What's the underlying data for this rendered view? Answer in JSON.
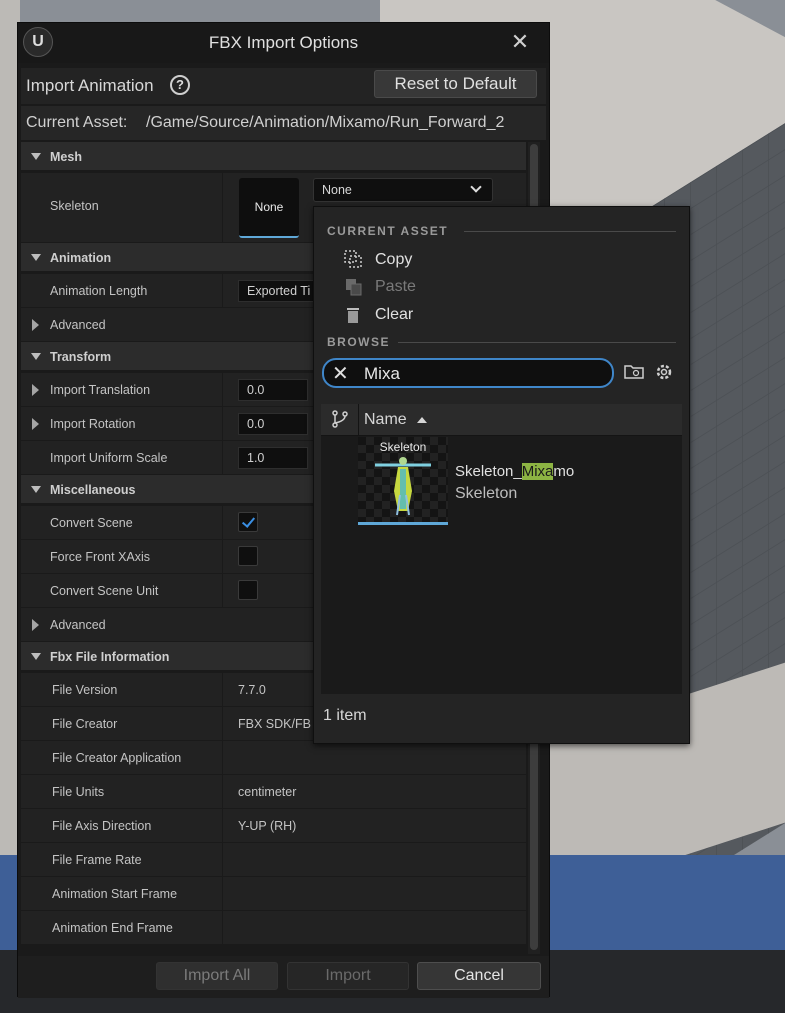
{
  "dialog": {
    "title": "FBX Import Options",
    "logo": "U",
    "close_icon": "close-icon",
    "header_label": "Import Animation",
    "help_symbol": "?",
    "reset_label": "Reset to Default",
    "asset_label": "Current Asset:",
    "asset_path": "/Game/Source/Animation/Mixamo/Run_Forward_2"
  },
  "details": {
    "mesh": {
      "label": "Mesh",
      "skeleton_label": "Skeleton",
      "thumb_text": "None",
      "combo_value": "None"
    },
    "animation": {
      "label": "Animation",
      "length_label": "Animation Length",
      "length_value": "Exported Ti",
      "advanced_label": "Advanced"
    },
    "transform": {
      "label": "Transform",
      "translation_label": "Import Translation",
      "translation_value": "0.0",
      "rotation_label": "Import Rotation",
      "rotation_value": "0.0",
      "scale_label": "Import Uniform Scale",
      "scale_value": "1.0"
    },
    "misc": {
      "label": "Miscellaneous",
      "convert_scene_label": "Convert Scene",
      "convert_scene_checked": true,
      "force_front_label": "Force Front XAxis",
      "force_front_checked": false,
      "convert_unit_label": "Convert Scene Unit",
      "convert_unit_checked": false,
      "advanced_label": "Advanced"
    },
    "fbx_info": {
      "label": "Fbx File Information",
      "rows": [
        {
          "name": "File Version",
          "value": "7.7.0"
        },
        {
          "name": "File Creator",
          "value": "FBX SDK/FB"
        },
        {
          "name": "File Creator Application",
          "value": ""
        },
        {
          "name": "File Units",
          "value": "centimeter"
        },
        {
          "name": "File Axis Direction",
          "value": "Y-UP (RH)"
        },
        {
          "name": "File Frame Rate",
          "value": ""
        },
        {
          "name": "Animation Start Frame",
          "value": ""
        },
        {
          "name": "Animation End Frame",
          "value": ""
        }
      ]
    }
  },
  "footer": {
    "import_all": "Import All",
    "import": "Import",
    "cancel": "Cancel"
  },
  "popup": {
    "current_asset_header": "CURRENT ASSET",
    "copy": "Copy",
    "paste": "Paste",
    "clear": "Clear",
    "browse_header": "BROWSE",
    "search_value": "Mixa",
    "column_name": "Name",
    "items": [
      {
        "thumb_label": "Skeleton",
        "name_pre": "Skeleton_",
        "name_hl": "Mixa",
        "name_post": "mo",
        "type": "Skeleton"
      }
    ],
    "count": "1 item"
  },
  "colors": {
    "accent": "#3f86c9",
    "highlight": "#8db443",
    "thumb_underline": "#5fa8d8"
  }
}
